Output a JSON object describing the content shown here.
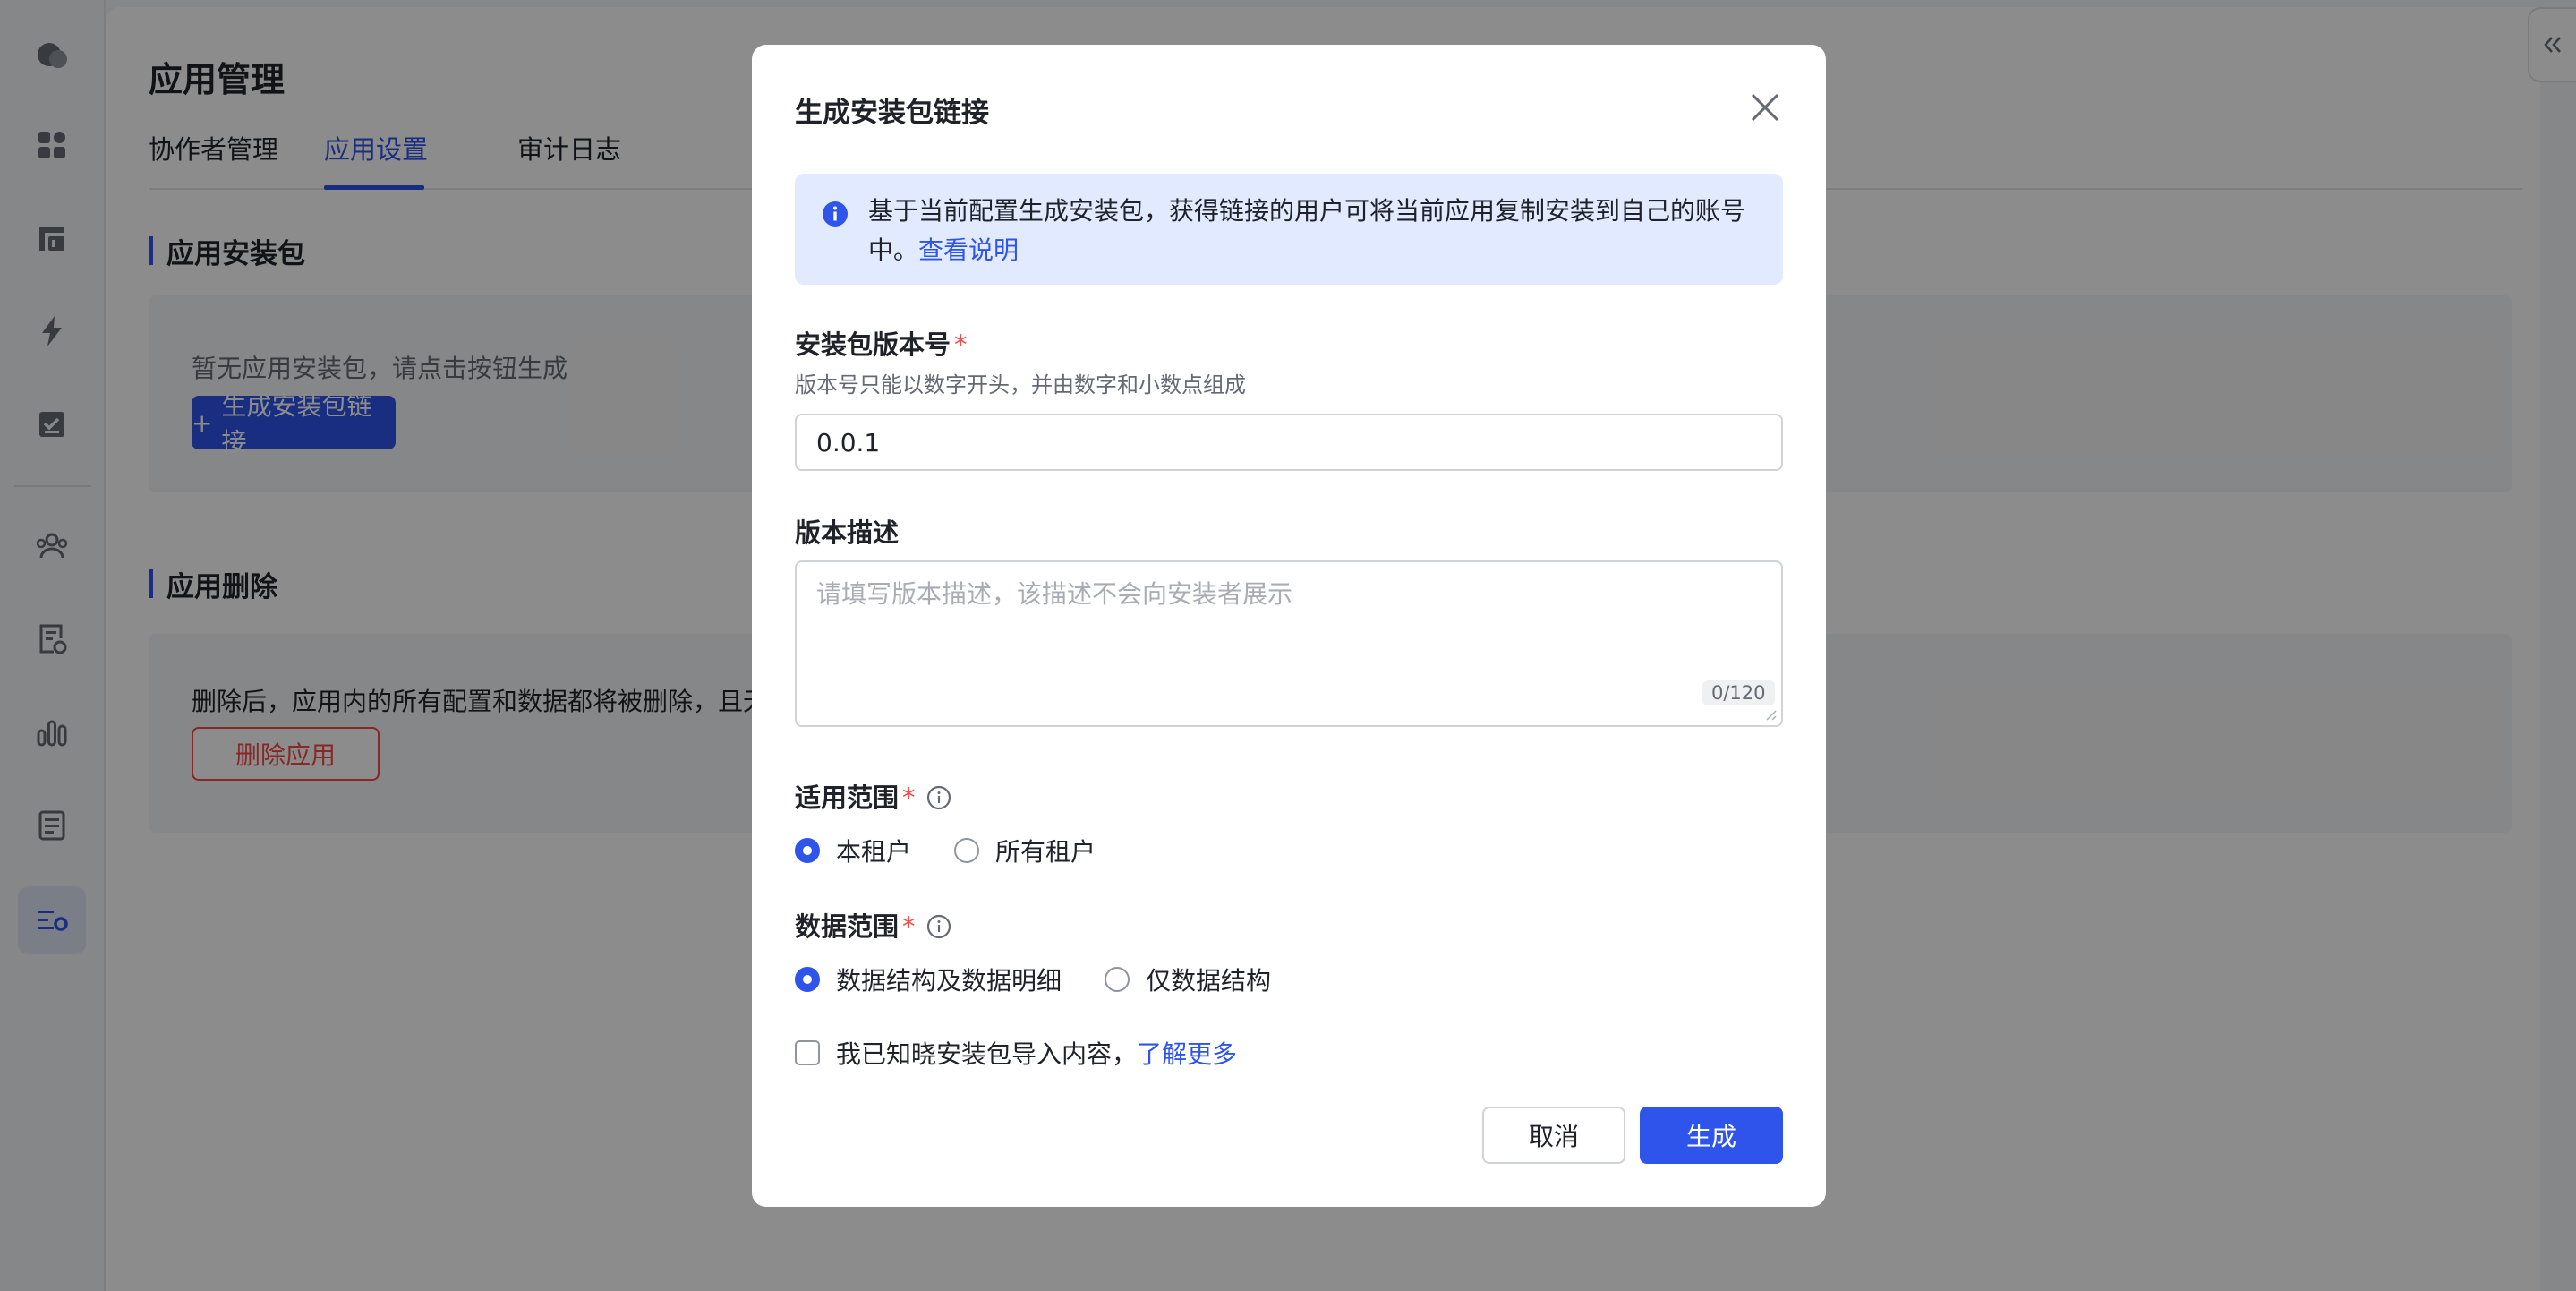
{
  "app": {
    "title": "应用管理",
    "tabs": [
      {
        "label": "协作者管理"
      },
      {
        "label": "应用设置"
      },
      {
        "label": "审计日志"
      }
    ],
    "active_tab": "应用设置",
    "package_section": {
      "title": "应用安装包",
      "empty_text": "暂无应用安装包，请点击按钮生成",
      "generate_button": "生成安装包链接"
    },
    "delete_section": {
      "title": "应用删除",
      "description": "删除后，应用内的所有配置和数据都将被删除，且无",
      "delete_button": "删除应用"
    },
    "sidebar_icons": [
      "chat-icon",
      "dashboard-icon",
      "data-table-icon",
      "automation-icon",
      "approval-icon",
      "members-icon",
      "form-settings-icon",
      "analytics-icon",
      "document-icon",
      "app-settings-icon"
    ]
  },
  "modal": {
    "title": "生成安装包链接",
    "info_text": "基于当前配置生成安装包，获得链接的用户可将当前应用复制安装到自己的账号中。",
    "info_link": "查看说明",
    "version": {
      "label": "安装包版本号",
      "required_mark": "*",
      "hint": "版本号只能以数字开头，并由数字和小数点组成",
      "value": "0.0.1"
    },
    "description": {
      "label": "版本描述",
      "placeholder": "请填写版本描述，该描述不会向安装者展示",
      "counter": "0/120"
    },
    "scope": {
      "label": "适用范围",
      "required_mark": "*",
      "options": [
        "本租户",
        "所有租户"
      ],
      "selected": "本租户"
    },
    "data_scope": {
      "label": "数据范围",
      "required_mark": "*",
      "options": [
        "数据结构及数据明细",
        "仅数据结构"
      ],
      "selected": "数据结构及数据明细"
    },
    "acknowledge": {
      "text": "我已知晓安装包导入内容，",
      "link": "了解更多",
      "checked": false
    },
    "cancel_button": "取消",
    "confirm_button": "生成"
  },
  "colors": {
    "accent": "#2f54eb",
    "danger": "#f54a45",
    "info_bg": "#e1eaff"
  }
}
